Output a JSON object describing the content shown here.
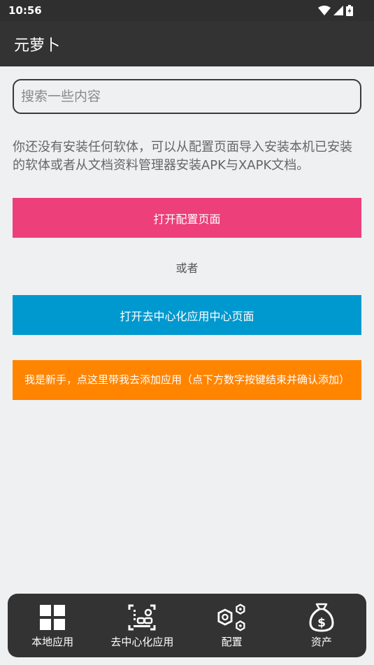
{
  "status_bar": {
    "time": "10:56",
    "icons": [
      "wifi-icon",
      "signal-icon",
      "battery-charging-icon"
    ]
  },
  "app_bar": {
    "title": "元萝卜"
  },
  "search": {
    "placeholder": "搜索一些内容",
    "value": ""
  },
  "info_text": "你还没有安装任何软体，可以从配置页面导入安装本机已安装的软体或者从文档资料管理器安装APK与XAPK文档。",
  "buttons": {
    "open_config": "打开配置页面",
    "or": "或者",
    "open_decentralized": "打开去中心化应用中心页面",
    "newbie": "我是新手，点这里带我去添加应用（点下方数字按键结束并确认添加）"
  },
  "bottom_nav": {
    "items": [
      {
        "label": "本地应用",
        "icon": "grid-icon"
      },
      {
        "label": "去中心化应用",
        "icon": "decentralized-icon"
      },
      {
        "label": "配置",
        "icon": "hexagons-icon"
      },
      {
        "label": "资产",
        "icon": "money-bag-icon"
      }
    ]
  },
  "colors": {
    "status_bar": "#2f2f2f",
    "app_bar": "#333333",
    "background": "#eff0f2",
    "config_button": "#ed3f7a",
    "decentralized_button": "#0099cf",
    "newbie_button": "#ff8400",
    "bottom_nav": "#333333"
  }
}
